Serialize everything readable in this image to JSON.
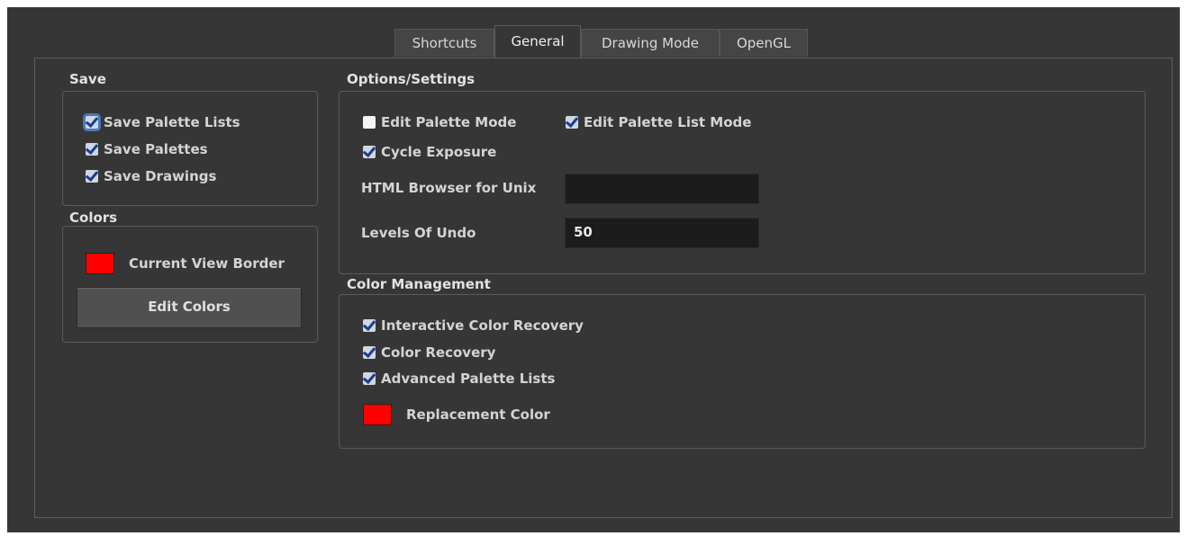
{
  "tabs": [
    {
      "label": "Shortcuts"
    },
    {
      "label": "General"
    },
    {
      "label": "Drawing Mode"
    },
    {
      "label": "OpenGL"
    }
  ],
  "active_tab": "General",
  "save": {
    "title": "Save",
    "items": [
      {
        "label": "Save Palette Lists",
        "checked": true
      },
      {
        "label": "Save Palettes",
        "checked": true
      },
      {
        "label": "Save Drawings",
        "checked": true
      }
    ]
  },
  "colors": {
    "title": "Colors",
    "current_view_border_label": "Current View Border",
    "current_view_border_color": "#ff0000",
    "edit_colors_label": "Edit Colors"
  },
  "options": {
    "title": "Options/Settings",
    "edit_palette_mode": {
      "label": "Edit Palette Mode",
      "checked": false
    },
    "edit_palette_list_mode": {
      "label": "Edit Palette List Mode",
      "checked": true
    },
    "cycle_exposure": {
      "label": "Cycle Exposure",
      "checked": true
    },
    "html_browser_label": "HTML Browser for Unix",
    "html_browser_value": "",
    "levels_of_undo_label": "Levels Of Undo",
    "levels_of_undo_value": "50"
  },
  "color_management": {
    "title": "Color Management",
    "items": [
      {
        "label": "Interactive Color Recovery",
        "checked": true
      },
      {
        "label": "Color Recovery",
        "checked": true
      },
      {
        "label": "Advanced Palette Lists",
        "checked": true
      }
    ],
    "replacement_color_label": "Replacement Color",
    "replacement_color": "#ff0000"
  }
}
